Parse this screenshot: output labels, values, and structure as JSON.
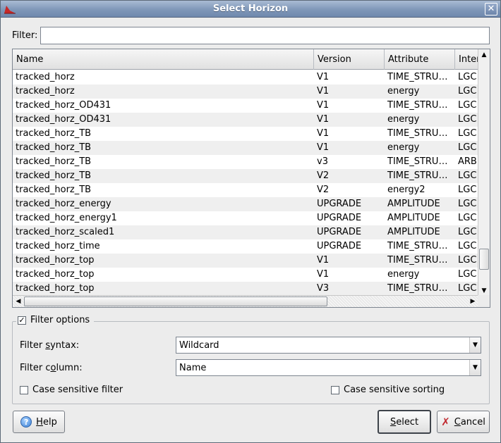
{
  "window": {
    "title": "Select Horizon",
    "close_label": "✕"
  },
  "filter": {
    "label": "Filter:",
    "value": ""
  },
  "table": {
    "columns": [
      "Name",
      "Version",
      "Attribute",
      "Interp"
    ],
    "rows": [
      [
        "tracked_horz",
        "V1",
        "TIME_STRU…",
        "LGC"
      ],
      [
        "tracked_horz",
        "V1",
        "energy",
        "LGC"
      ],
      [
        "tracked_horz_OD431",
        "V1",
        "TIME_STRU…",
        "LGC"
      ],
      [
        "tracked_horz_OD431",
        "V1",
        "energy",
        "LGC"
      ],
      [
        "tracked_horz_TB",
        "V1",
        "TIME_STRU…",
        "LGC"
      ],
      [
        "tracked_horz_TB",
        "V1",
        "energy",
        "LGC"
      ],
      [
        "tracked_horz_TB",
        "v3",
        "TIME_STRU…",
        "ARB"
      ],
      [
        "tracked_horz_TB",
        "V2",
        "TIME_STRU…",
        "LGC"
      ],
      [
        "tracked_horz_TB",
        "V2",
        "energy2",
        "LGC"
      ],
      [
        "tracked_horz_energy",
        "UPGRADE",
        "AMPLITUDE",
        "LGC"
      ],
      [
        "tracked_horz_energy1",
        "UPGRADE",
        "AMPLITUDE",
        "LGC"
      ],
      [
        "tracked_horz_scaled1",
        "UPGRADE",
        "AMPLITUDE",
        "LGC"
      ],
      [
        "tracked_horz_time",
        "UPGRADE",
        "TIME_STRU…",
        "LGC"
      ],
      [
        "tracked_horz_top",
        "V1",
        "TIME_STRU…",
        "LGC"
      ],
      [
        "tracked_horz_top",
        "V1",
        "energy",
        "LGC"
      ],
      [
        "tracked_horz_top",
        "V3",
        "TIME_STRU…",
        "LGC"
      ]
    ]
  },
  "options": {
    "group_label": "Filter options",
    "group_checked": true,
    "syntax_label_pre": "Filter ",
    "syntax_label_u": "s",
    "syntax_label_post": "yntax:",
    "syntax_value": "Wildcard",
    "column_label_pre": "Filter c",
    "column_label_u": "o",
    "column_label_post": "lumn:",
    "column_value": "Name",
    "case_filter_label": "Case sensitive filter",
    "case_filter_checked": false,
    "case_sort_label": "Case sensitive sorting",
    "case_sort_checked": false
  },
  "buttons": {
    "help_u": "H",
    "help_rest": "elp",
    "select_u": "S",
    "select_rest": "elect",
    "cancel_u": "C",
    "cancel_rest": "ancel"
  }
}
